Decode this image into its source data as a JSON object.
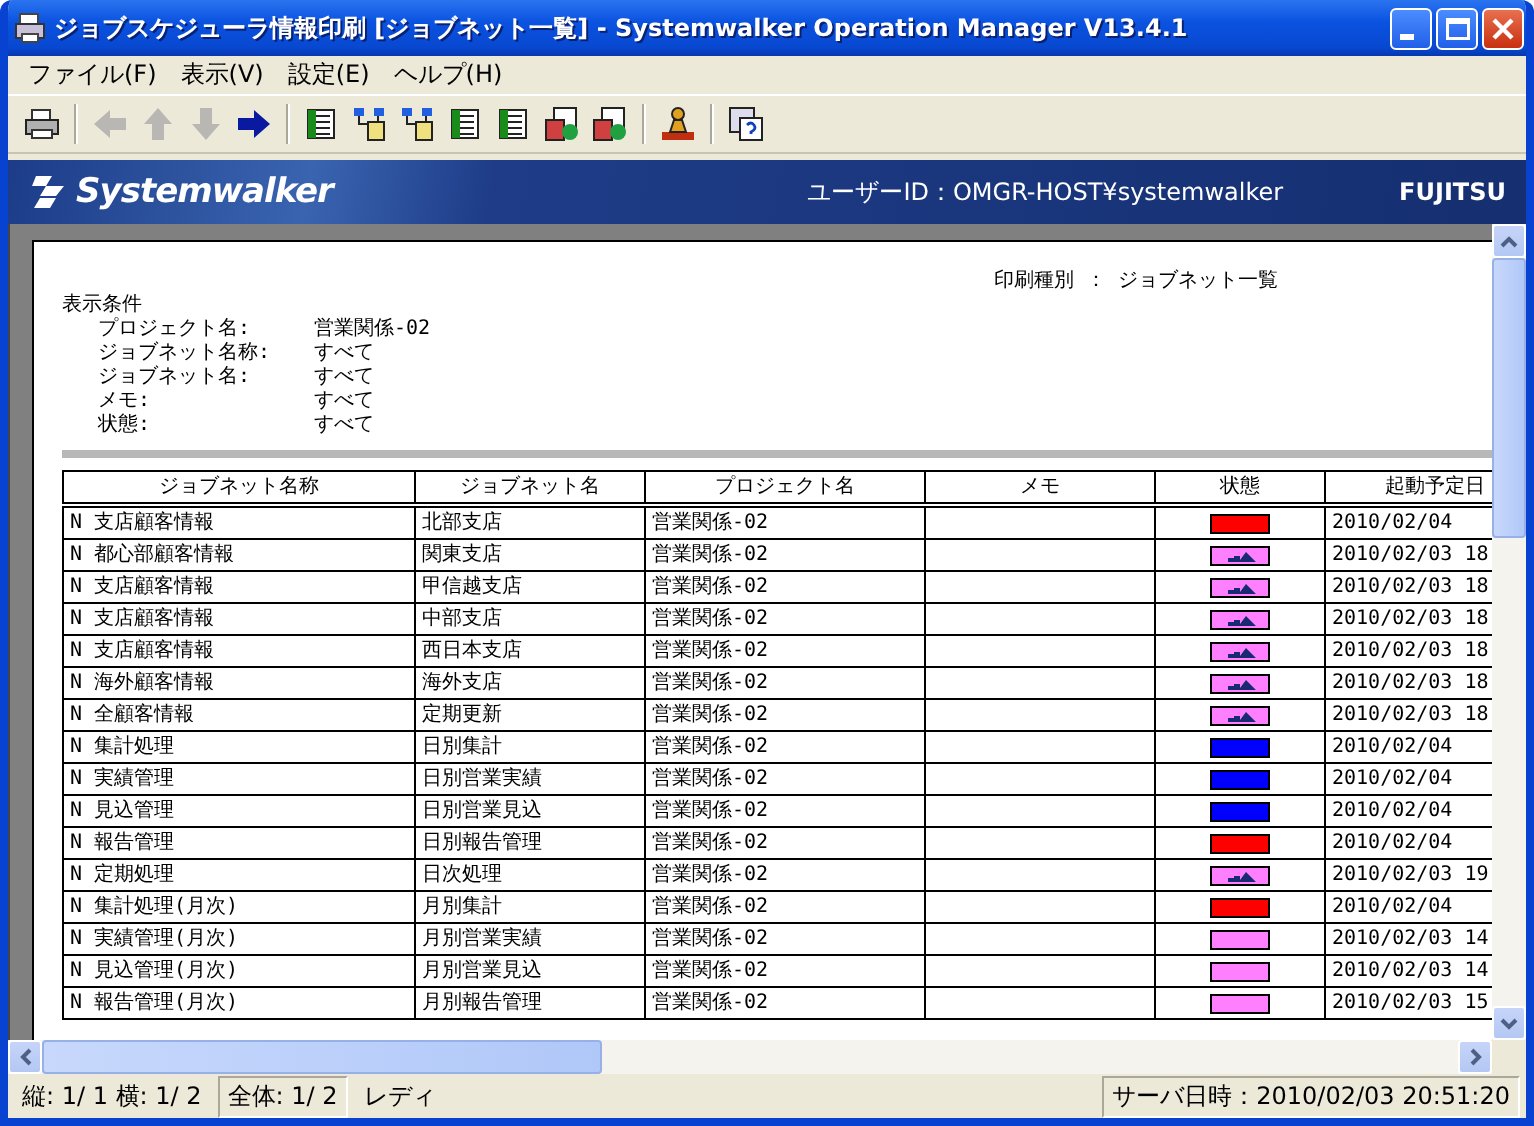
{
  "window": {
    "title": "ジョブスケジューラ情報印刷 [ジョブネット一覧] - Systemwalker Operation Manager  V13.4.1"
  },
  "menu": [
    "ファイル(F)",
    "表示(V)",
    "設定(E)",
    "ヘルプ(H)"
  ],
  "toolbar": [
    {
      "kind": "printer",
      "disabled": false
    },
    {
      "kind": "separator"
    },
    {
      "kind": "arrow-left",
      "disabled": true
    },
    {
      "kind": "arrow-up",
      "disabled": true
    },
    {
      "kind": "arrow-down",
      "disabled": true
    },
    {
      "kind": "arrow-right",
      "disabled": false
    },
    {
      "kind": "separator"
    },
    {
      "kind": "sheet",
      "disabled": false
    },
    {
      "kind": "tree",
      "disabled": false
    },
    {
      "kind": "tree",
      "disabled": false
    },
    {
      "kind": "sheet",
      "disabled": false
    },
    {
      "kind": "sheet",
      "disabled": false
    },
    {
      "kind": "doc",
      "disabled": false
    },
    {
      "kind": "doc",
      "disabled": false
    },
    {
      "kind": "separator"
    },
    {
      "kind": "tool",
      "disabled": false
    },
    {
      "kind": "separator"
    },
    {
      "kind": "help",
      "disabled": false
    }
  ],
  "banner": {
    "logo": "Systemwalker",
    "user": "ユーザーID：OMGR-HOST¥systemwalker",
    "vendor": "FUJITSU"
  },
  "report": {
    "print_type": "印刷種別 ： ジョブネット一覧",
    "conditions_title": "表示条件",
    "conditions": [
      {
        "label": "プロジェクト名:",
        "value": "営業関係-02"
      },
      {
        "label": "ジョブネット名称:",
        "value": "すべて"
      },
      {
        "label": "ジョブネット名:",
        "value": "すべて"
      },
      {
        "label": "メモ:",
        "value": "すべて"
      },
      {
        "label": "状態:",
        "value": "すべて"
      }
    ]
  },
  "table": {
    "columns": [
      "ジョブネット名称",
      "ジョブネット名",
      "プロジェクト名",
      "メモ",
      "状態",
      "起動予定日"
    ],
    "rows": [
      {
        "comment": "N 支店顧客情報",
        "name": "北部支店",
        "project": "営業関係-02",
        "status": {
          "kind": "bar",
          "color": "#ff0000"
        },
        "date": "2010/02/04"
      },
      {
        "comment": "N 都心部顧客情報",
        "name": "関東支店",
        "project": "営業関係-02",
        "status": {
          "kind": "running",
          "color": "#ff80ff"
        },
        "date": "2010/02/03 18"
      },
      {
        "comment": "N 支店顧客情報",
        "name": "甲信越支店",
        "project": "営業関係-02",
        "status": {
          "kind": "running",
          "color": "#ff80ff"
        },
        "date": "2010/02/03 18"
      },
      {
        "comment": "N 支店顧客情報",
        "name": "中部支店",
        "project": "営業関係-02",
        "status": {
          "kind": "running",
          "color": "#ff80ff"
        },
        "date": "2010/02/03 18"
      },
      {
        "comment": "N 支店顧客情報",
        "name": "西日本支店",
        "project": "営業関係-02",
        "status": {
          "kind": "running",
          "color": "#ff80ff"
        },
        "date": "2010/02/03 18"
      },
      {
        "comment": "N 海外顧客情報",
        "name": "海外支店",
        "project": "営業関係-02",
        "status": {
          "kind": "running",
          "color": "#ff80ff"
        },
        "date": "2010/02/03 18"
      },
      {
        "comment": "N 全顧客情報",
        "name": "定期更新",
        "project": "営業関係-02",
        "status": {
          "kind": "running",
          "color": "#ff80ff"
        },
        "date": "2010/02/03 18"
      },
      {
        "comment": "N 集計処理",
        "name": "日別集計",
        "project": "営業関係-02",
        "status": {
          "kind": "bar",
          "color": "#0000ff"
        },
        "date": "2010/02/04"
      },
      {
        "comment": "N 実績管理",
        "name": "日別営業実績",
        "project": "営業関係-02",
        "status": {
          "kind": "bar",
          "color": "#0000ff"
        },
        "date": "2010/02/04"
      },
      {
        "comment": "N 見込管理",
        "name": "日別営業見込",
        "project": "営業関係-02",
        "status": {
          "kind": "bar",
          "color": "#0000ff"
        },
        "date": "2010/02/04"
      },
      {
        "comment": "N 報告管理",
        "name": "日別報告管理",
        "project": "営業関係-02",
        "status": {
          "kind": "bar",
          "color": "#ff0000"
        },
        "date": "2010/02/04"
      },
      {
        "comment": "N 定期処理",
        "name": "日次処理",
        "project": "営業関係-02",
        "status": {
          "kind": "running",
          "color": "#ff80ff"
        },
        "date": "2010/02/03 19"
      },
      {
        "comment": "N 集計処理(月次)",
        "name": "月別集計",
        "project": "営業関係-02",
        "status": {
          "kind": "bar",
          "color": "#ff0000"
        },
        "date": "2010/02/04"
      },
      {
        "comment": "N 実績管理(月次)",
        "name": "月別営業実績",
        "project": "営業関係-02",
        "status": {
          "kind": "bar",
          "color": "#ff80ff"
        },
        "date": "2010/02/03 14"
      },
      {
        "comment": "N 見込管理(月次)",
        "name": "月別営業見込",
        "project": "営業関係-02",
        "status": {
          "kind": "bar",
          "color": "#ff80ff"
        },
        "date": "2010/02/03 14"
      },
      {
        "comment": "N 報告管理(月次)",
        "name": "月別報告管理",
        "project": "営業関係-02",
        "status": {
          "kind": "bar",
          "color": "#ff80ff"
        },
        "date": "2010/02/03 15"
      }
    ]
  },
  "status_bar": {
    "page_position": "縦: 1/ 1 横: 1/ 2",
    "total": "全体:  1/  2",
    "state": "レディ",
    "server_time": "サーバ日時：2010/02/03 20:51:20"
  }
}
